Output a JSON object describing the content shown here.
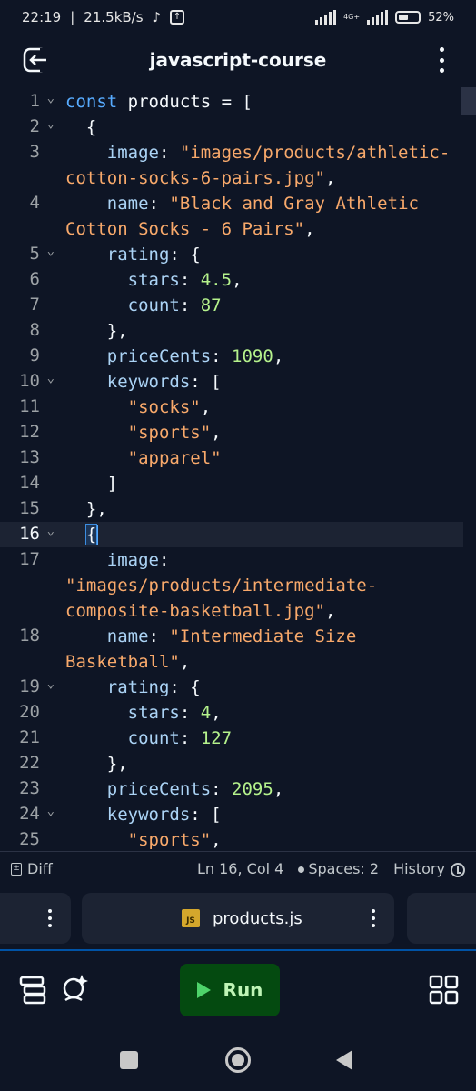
{
  "status_bar": {
    "time": "22:19",
    "net_speed": "21.5kB/s",
    "network_label": "4G+",
    "battery": "52"
  },
  "header": {
    "title": "javascript-course",
    "back_icon": "exit-arrow-icon",
    "menu_icon": "kebab-menu-icon"
  },
  "editor": {
    "active_line": 16,
    "lines": [
      {
        "n": "1",
        "fold": true,
        "tokens": [
          [
            "kw",
            "const "
          ],
          [
            "punct",
            "products = ["
          ]
        ]
      },
      {
        "n": "2",
        "fold": true,
        "tokens": [
          [
            "punct",
            "  {"
          ]
        ]
      },
      {
        "n": "3",
        "fold": false,
        "tokens": [
          [
            "prop",
            "    image"
          ],
          [
            "punct",
            ": "
          ],
          [
            "str",
            "\"images/products/athletic-"
          ]
        ]
      },
      {
        "n": "",
        "fold": false,
        "tokens": [
          [
            "str",
            "cotton-socks-6-pairs.jpg\""
          ],
          [
            "punct",
            ","
          ]
        ]
      },
      {
        "n": "4",
        "fold": false,
        "tokens": [
          [
            "prop",
            "    name"
          ],
          [
            "punct",
            ": "
          ],
          [
            "str",
            "\"Black and Gray Athletic"
          ]
        ]
      },
      {
        "n": "",
        "fold": false,
        "tokens": [
          [
            "str",
            "Cotton Socks - 6 Pairs\""
          ],
          [
            "punct",
            ","
          ]
        ]
      },
      {
        "n": "5",
        "fold": true,
        "tokens": [
          [
            "prop",
            "    rating"
          ],
          [
            "punct",
            ": {"
          ]
        ]
      },
      {
        "n": "6",
        "fold": false,
        "tokens": [
          [
            "prop",
            "      stars"
          ],
          [
            "punct",
            ": "
          ],
          [
            "num",
            "4.5"
          ],
          [
            "punct",
            ","
          ]
        ]
      },
      {
        "n": "7",
        "fold": false,
        "tokens": [
          [
            "prop",
            "      count"
          ],
          [
            "punct",
            ": "
          ],
          [
            "num",
            "87"
          ]
        ]
      },
      {
        "n": "8",
        "fold": false,
        "tokens": [
          [
            "punct",
            "    },"
          ]
        ]
      },
      {
        "n": "9",
        "fold": false,
        "tokens": [
          [
            "prop",
            "    priceCents"
          ],
          [
            "punct",
            ": "
          ],
          [
            "num",
            "1090"
          ],
          [
            "punct",
            ","
          ]
        ]
      },
      {
        "n": "10",
        "fold": true,
        "tokens": [
          [
            "prop",
            "    keywords"
          ],
          [
            "punct",
            ": ["
          ]
        ]
      },
      {
        "n": "11",
        "fold": false,
        "tokens": [
          [
            "punct",
            "      "
          ],
          [
            "str",
            "\"socks\""
          ],
          [
            "punct",
            ","
          ]
        ]
      },
      {
        "n": "12",
        "fold": false,
        "tokens": [
          [
            "punct",
            "      "
          ],
          [
            "str",
            "\"sports\""
          ],
          [
            "punct",
            ","
          ]
        ]
      },
      {
        "n": "13",
        "fold": false,
        "tokens": [
          [
            "punct",
            "      "
          ],
          [
            "str",
            "\"apparel\""
          ]
        ]
      },
      {
        "n": "14",
        "fold": false,
        "tokens": [
          [
            "punct",
            "    ]"
          ]
        ]
      },
      {
        "n": "15",
        "fold": false,
        "tokens": [
          [
            "punct",
            "  },"
          ]
        ]
      },
      {
        "n": "16",
        "fold": true,
        "tokens": [
          [
            "punct",
            "  "
          ],
          [
            "cursor",
            "{"
          ]
        ]
      },
      {
        "n": "17",
        "fold": false,
        "tokens": [
          [
            "prop",
            "    image"
          ],
          [
            "punct",
            ":"
          ]
        ]
      },
      {
        "n": "",
        "fold": false,
        "tokens": [
          [
            "str",
            "\"images/products/intermediate-"
          ]
        ]
      },
      {
        "n": "",
        "fold": false,
        "tokens": [
          [
            "str",
            "composite-basketball.jpg\""
          ],
          [
            "punct",
            ","
          ]
        ]
      },
      {
        "n": "18",
        "fold": false,
        "tokens": [
          [
            "prop",
            "    name"
          ],
          [
            "punct",
            ": "
          ],
          [
            "str",
            "\"Intermediate Size"
          ]
        ]
      },
      {
        "n": "",
        "fold": false,
        "tokens": [
          [
            "str",
            "Basketball\""
          ],
          [
            "punct",
            ","
          ]
        ]
      },
      {
        "n": "19",
        "fold": true,
        "tokens": [
          [
            "prop",
            "    rating"
          ],
          [
            "punct",
            ": {"
          ]
        ]
      },
      {
        "n": "20",
        "fold": false,
        "tokens": [
          [
            "prop",
            "      stars"
          ],
          [
            "punct",
            ": "
          ],
          [
            "num",
            "4"
          ],
          [
            "punct",
            ","
          ]
        ]
      },
      {
        "n": "21",
        "fold": false,
        "tokens": [
          [
            "prop",
            "      count"
          ],
          [
            "punct",
            ": "
          ],
          [
            "num",
            "127"
          ]
        ]
      },
      {
        "n": "22",
        "fold": false,
        "tokens": [
          [
            "punct",
            "    },"
          ]
        ]
      },
      {
        "n": "23",
        "fold": false,
        "tokens": [
          [
            "prop",
            "    priceCents"
          ],
          [
            "punct",
            ": "
          ],
          [
            "num",
            "2095"
          ],
          [
            "punct",
            ","
          ]
        ]
      },
      {
        "n": "24",
        "fold": true,
        "tokens": [
          [
            "prop",
            "    keywords"
          ],
          [
            "punct",
            ": ["
          ]
        ]
      },
      {
        "n": "25",
        "fold": false,
        "tokens": [
          [
            "punct",
            "      "
          ],
          [
            "str",
            "\"sports\""
          ],
          [
            "punct",
            ","
          ]
        ]
      }
    ]
  },
  "info_bar": {
    "diff_label": "Diff",
    "cursor_position": "Ln 16, Col 4",
    "spaces_label": "Spaces: 2",
    "history_label": "History"
  },
  "file_tabs": {
    "active_file": "products.js",
    "badge": "JS"
  },
  "toolbar": {
    "run_label": "Run",
    "left_icons": [
      "stack-layers-icon",
      "ai-assistant-icon"
    ],
    "right_icon": "grid-apps-icon"
  },
  "colors": {
    "background": "#0e1525",
    "keyword": "#57abff",
    "string": "#f8a96b",
    "number": "#b5f28c",
    "property": "#abd3f5",
    "run_button": "#044a10"
  }
}
